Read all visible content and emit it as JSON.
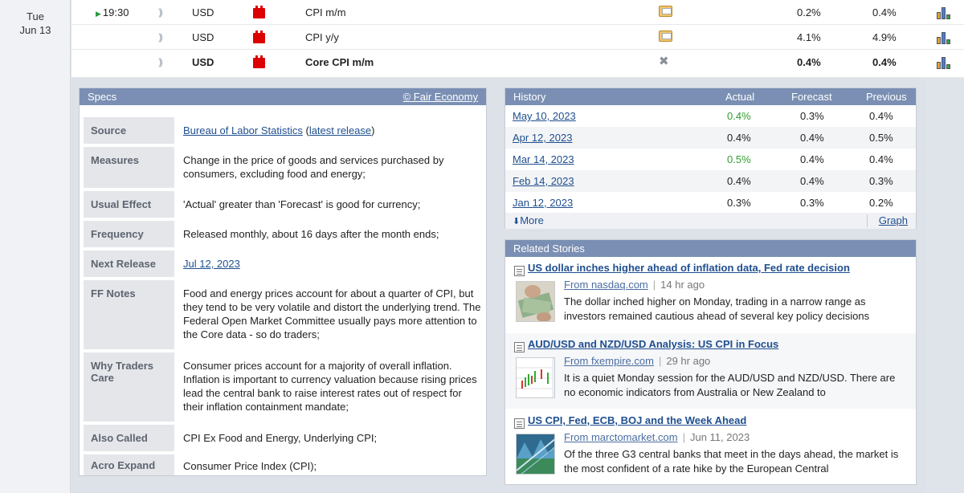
{
  "date": {
    "weekday": "Tue",
    "monthday": "Jun 13"
  },
  "events": [
    {
      "time": "19:30",
      "currency": "USD",
      "name": "CPI m/m",
      "detail_icon": "folder-icon",
      "actual": "0.2%",
      "previous": "0.4%"
    },
    {
      "time": "",
      "currency": "USD",
      "name": "CPI y/y",
      "detail_icon": "folder-icon",
      "actual": "4.1%",
      "previous": "4.9%"
    },
    {
      "time": "",
      "currency": "USD",
      "name": "Core CPI m/m",
      "detail_icon": "close-icon",
      "actual": "0.4%",
      "previous": "0.4%"
    }
  ],
  "colors": {
    "impact_high": "#dd0000",
    "panel_header": "#7a8fb3",
    "link": "#1f4f8f",
    "positive": "#2f9d2f"
  },
  "specs": {
    "title": "Specs",
    "credit": "© Fair Economy",
    "source_label": "Source",
    "source_link": "Bureau of Labor Statistics",
    "source_release": "latest release",
    "rows": [
      {
        "label": "Measures",
        "value": "Change in the price of goods and services purchased by consumers, excluding food and energy;"
      },
      {
        "label": "Usual Effect",
        "value": "'Actual' greater than 'Forecast' is good for currency;"
      },
      {
        "label": "Frequency",
        "value": "Released monthly, about 16 days after the month ends;"
      },
      {
        "label": "Next Release",
        "value": "Jul 12, 2023"
      },
      {
        "label": "FF Notes",
        "value": "Food and energy prices account for about a quarter of CPI, but they tend to be very volatile and distort the underlying trend. The Federal Open Market Committee usually pays more attention to the Core data - so do traders;"
      },
      {
        "label": "Why Traders Care",
        "value": "Consumer prices account for a majority of overall inflation. Inflation is important to currency valuation because rising prices lead the central bank to raise interest rates out of respect for their inflation containment mandate;"
      },
      {
        "label": "Also Called",
        "value": "CPI Ex Food and Energy, Underlying CPI;"
      },
      {
        "label": "Acro Expand",
        "value": "Consumer Price Index (CPI);"
      }
    ]
  },
  "history": {
    "title": "History",
    "col_actual": "Actual",
    "col_forecast": "Forecast",
    "col_previous": "Previous",
    "rows": [
      {
        "date": "May 10, 2023",
        "actual": "0.4%",
        "forecast": "0.3%",
        "previous": "0.4%"
      },
      {
        "date": "Apr 12, 2023",
        "actual": "0.4%",
        "forecast": "0.4%",
        "previous": "0.5%"
      },
      {
        "date": "Mar 14, 2023",
        "actual": "0.5%",
        "forecast": "0.4%",
        "previous": "0.4%"
      },
      {
        "date": "Feb 14, 2023",
        "actual": "0.4%",
        "forecast": "0.4%",
        "previous": "0.3%"
      },
      {
        "date": "Jan 12, 2023",
        "actual": "0.3%",
        "forecast": "0.3%",
        "previous": "0.2%"
      }
    ],
    "more": "More",
    "graph": "Graph"
  },
  "related": {
    "title": "Related Stories",
    "stories": [
      {
        "title": "US dollar inches higher ahead of inflation data, Fed rate decision",
        "source": "From nasdaq.com",
        "age": "14 hr ago",
        "text": "The dollar inched higher on Monday, trading in a narrow range as investors remained cautious ahead of several key policy decisions"
      },
      {
        "title": "AUD/USD and NZD/USD Analysis: US CPI in Focus",
        "source": "From fxempire.com",
        "age": "29 hr ago",
        "text": "It is a quiet Monday session for the AUD/USD and NZD/USD. There are no economic indicators from Australia or New Zealand to"
      },
      {
        "title": "US CPI, Fed, ECB, BOJ and the Week Ahead",
        "source": "From marctomarket.com",
        "age": "Jun 11, 2023",
        "text": "Of the three G3 central banks that meet in the days ahead, the market is the most confident of a rate hike by the European Central"
      }
    ]
  }
}
